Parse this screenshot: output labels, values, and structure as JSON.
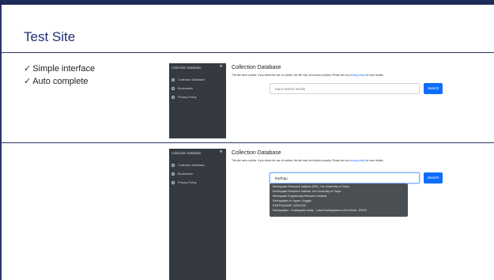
{
  "slide": {
    "title": "Test Site",
    "bullets": [
      {
        "check": "✓",
        "text": "Simple interface"
      },
      {
        "check": "✓",
        "text": "Auto complete"
      }
    ]
  },
  "app": {
    "sidebar_title": "Collection Database",
    "collapse_icon": "«",
    "nav": [
      "Collection Database",
      "Bookmarks",
      "Privacy Policy"
    ],
    "page_title": "Collection Database",
    "cookie_notice_before": "This site uses cookies. If you refuse the use of cookies, the site may not function properly. Please see our ",
    "cookie_notice_link": "privacy policy",
    "cookie_notice_after": " for more details.",
    "search_placeholder": "Input search words",
    "search_label": "Search"
  },
  "screenshot2": {
    "query": "Earthqu",
    "suggestions": [
      "Earthquake Research Institute (ERI), The University of Tokyo",
      "Earthquake Research Institute, the University of Tokyo",
      "Earthquake Engineering Research Institute",
      "Earthquakes in Japan | Kaggle",
      "EARTHQUAKE CATALOG",
      "Earthquakes - Earthquake today - Latest Earthquakes in the World - EMSC"
    ]
  }
}
